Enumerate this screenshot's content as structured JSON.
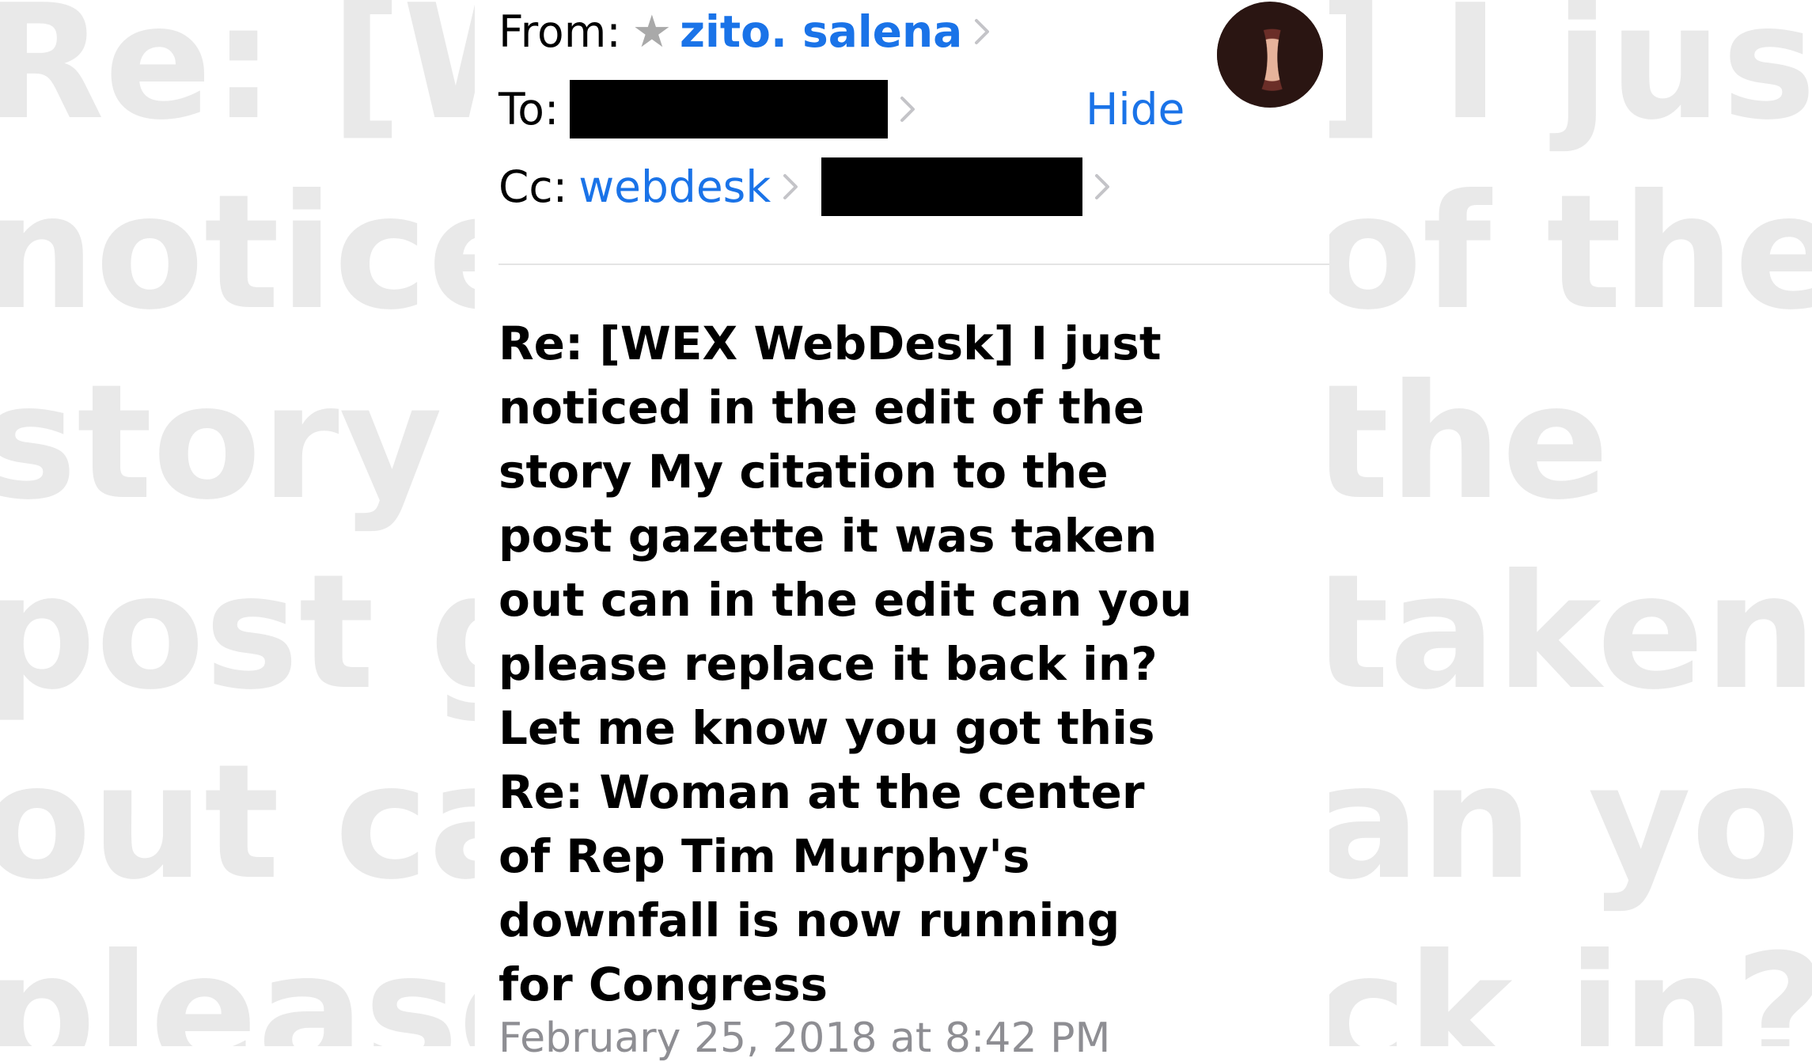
{
  "background_echo": {
    "left_lines": [
      "Re: [WE",
      "noticed",
      "story M",
      "post ga",
      "out can",
      "please r"
    ],
    "right_lines": [
      "] I just",
      "of the",
      "the",
      "taken",
      "an you",
      "ck in?"
    ]
  },
  "header": {
    "from_label": "From:",
    "from_star_icon": "star-icon",
    "from_name": "zito. salena",
    "to_label": "To:",
    "cc_label": "Cc:",
    "cc_first": "webdesk",
    "hide_label": "Hide"
  },
  "message": {
    "subject": "Re: [WEX WebDesk] I just\nnoticed in the edit of the\nstory My citation to the\npost gazette it was taken\nout can in the edit can you\nplease replace it back in?\nLet me know you got this\nRe: Woman at the center\nof Rep Tim Murphy's\ndownfall is now running\nfor Congress",
    "date": "February 25, 2018 at 8:42 PM"
  },
  "colors": {
    "link": "#1a73e8",
    "secondary_text": "#8e8e93",
    "redaction": "#000000",
    "background_echo": "#e9e9e9"
  }
}
